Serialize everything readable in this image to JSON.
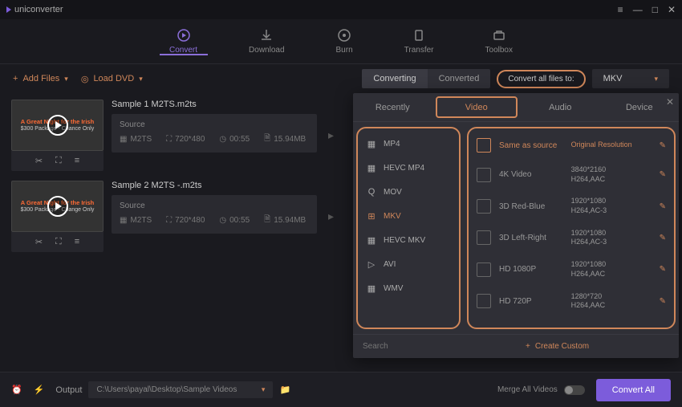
{
  "app": {
    "name": "uniconverter"
  },
  "nav": [
    {
      "label": "Convert",
      "active": true
    },
    {
      "label": "Download"
    },
    {
      "label": "Burn"
    },
    {
      "label": "Transfer"
    },
    {
      "label": "Toolbox"
    }
  ],
  "toolbar": {
    "add_files": "Add Files",
    "load_dvd": "Load DVD",
    "seg_converting": "Converting",
    "seg_converted": "Converted",
    "convert_to_label": "Convert all files to:",
    "selected_format": "MKV"
  },
  "files": [
    {
      "name": "Sample 1 M2TS.m2ts",
      "source_label": "Source",
      "codec": "M2TS",
      "resolution": "720*480",
      "duration": "00:55",
      "size": "15.94MB",
      "thumb_title": "A Great Night for the Irish",
      "thumb_sub": "$300 Package - Chance Only"
    },
    {
      "name": "Sample 2 M2TS -.m2ts",
      "source_label": "Source",
      "codec": "M2TS",
      "resolution": "720*480",
      "duration": "00:55",
      "size": "15.94MB",
      "thumb_title": "A Great Night for the Irish",
      "thumb_sub": "$300 Package - Change Only"
    }
  ],
  "dropdown": {
    "tabs": [
      "Recently",
      "Video",
      "Audio",
      "Device"
    ],
    "active_tab": "Video",
    "containers": [
      "MP4",
      "HEVC MP4",
      "MOV",
      "MKV",
      "HEVC MKV",
      "AVI",
      "WMV"
    ],
    "active_container": "MKV",
    "presets": [
      {
        "name": "Same as source",
        "res": "Original Resolution",
        "codec": "",
        "active": true
      },
      {
        "name": "4K Video",
        "res": "3840*2160",
        "codec": "H264,AAC"
      },
      {
        "name": "3D Red-Blue",
        "res": "1920*1080",
        "codec": "H264,AC-3"
      },
      {
        "name": "3D Left-Right",
        "res": "1920*1080",
        "codec": "H264,AC-3"
      },
      {
        "name": "HD 1080P",
        "res": "1920*1080",
        "codec": "H264,AAC"
      },
      {
        "name": "HD 720P",
        "res": "1280*720",
        "codec": "H264,AAC"
      }
    ],
    "search_placeholder": "Search",
    "create_custom": "Create Custom"
  },
  "bottom": {
    "output_label": "Output",
    "output_path": "C:\\Users\\payal\\Desktop\\Sample Videos",
    "merge_label": "Merge All Videos",
    "convert_all": "Convert All"
  }
}
